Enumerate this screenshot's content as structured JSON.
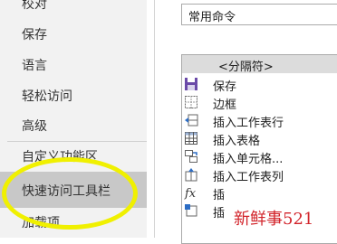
{
  "nav": {
    "items": [
      {
        "label": "校对"
      },
      {
        "label": "保存"
      },
      {
        "label": "语言"
      },
      {
        "label": "轻松访问"
      },
      {
        "label": "高级"
      },
      {
        "label": "自定义功能区"
      },
      {
        "label": "快速访问工具栏",
        "selected": true
      },
      {
        "label": "加载项"
      }
    ]
  },
  "commands": {
    "dropdown_value": "常用命令",
    "list": [
      {
        "label": "<分隔符>",
        "icon": "separator"
      },
      {
        "label": "保存",
        "icon": "save-icon"
      },
      {
        "label": "边框",
        "icon": "border-icon"
      },
      {
        "label": "插入工作表行",
        "icon": "insert-row-icon"
      },
      {
        "label": "插入表格",
        "icon": "insert-table-icon"
      },
      {
        "label": "插入单元格...",
        "icon": "insert-cells-icon"
      },
      {
        "label": "插入工作表列",
        "icon": "insert-column-icon"
      },
      {
        "label": "插",
        "icon": "function-icon"
      },
      {
        "label": "插",
        "icon": "insert-icon"
      }
    ]
  },
  "annotation": {
    "highlight_color": "#f0f000"
  },
  "watermark": {
    "text": "新鲜事521",
    "color": "#d2232a"
  }
}
